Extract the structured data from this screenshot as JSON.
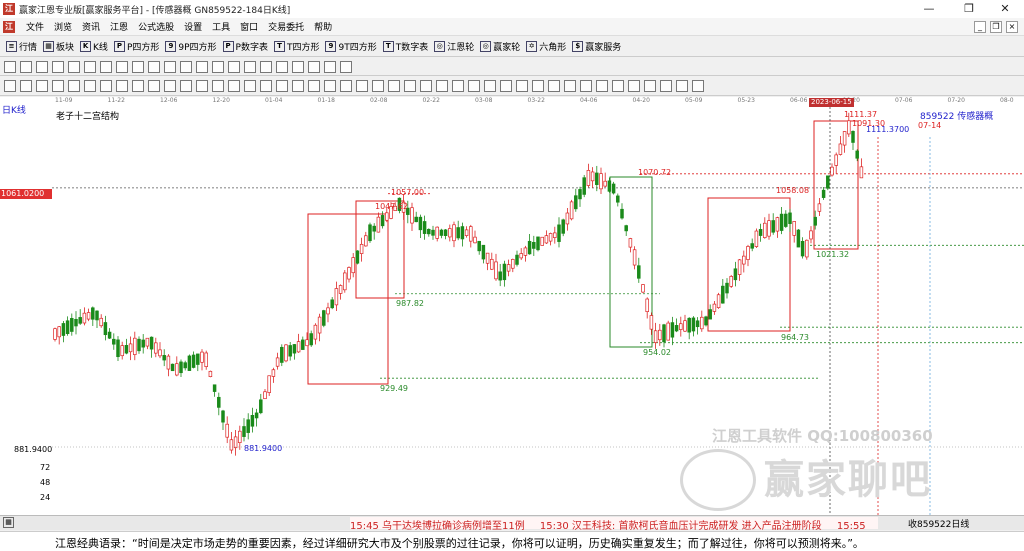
{
  "window": {
    "title": "赢家江恩专业版[赢家服务平台] - [传感器概  GN859522-184日K线]",
    "app_icon": "江"
  },
  "menu": [
    "文件",
    "浏览",
    "资讯",
    "江恩",
    "公式选股",
    "设置",
    "工具",
    "窗口",
    "交易委托",
    "帮助"
  ],
  "toolbar1": [
    {
      "icon": "≡",
      "label": "行情"
    },
    {
      "icon": "▦",
      "label": "板块"
    },
    {
      "icon": "K",
      "label": "K线"
    },
    {
      "icon": "P",
      "label": "P四方形"
    },
    {
      "icon": "9",
      "label": "9P四方形"
    },
    {
      "icon": "P",
      "label": "P数字表"
    },
    {
      "icon": "T",
      "label": "T四方形"
    },
    {
      "icon": "9",
      "label": "9T四方形"
    },
    {
      "icon": "T",
      "label": "T数字表"
    },
    {
      "icon": "◎",
      "label": "江恩轮"
    },
    {
      "icon": "◎",
      "label": "赢家轮"
    },
    {
      "icon": "✡",
      "label": "六角形"
    },
    {
      "icon": "$",
      "label": "赢家服务"
    }
  ],
  "chart": {
    "period_label": "日K线",
    "indicator_label": "老子十二宫结构",
    "security_label": "859522 传感器概",
    "current_price_label": "1061.0200",
    "low_axis_label": "881.9400",
    "low_marker_label": "881.9400",
    "high_marker_label": "1111.3700",
    "high_mark_label": "1111.37",
    "date_highlight": "2023-06-15",
    "future_date_label": "07-14",
    "date_ticks": [
      "11-09",
      "11-22",
      "12-06",
      "12-20",
      "01-04",
      "01-18",
      "02-08",
      "02-22",
      "03-08",
      "03-22",
      "04-06",
      "04-20",
      "05-09",
      "05-23",
      "06-06",
      "06-20",
      "07-06",
      "07-20",
      "08-0"
    ],
    "volume_ticks": [
      "72",
      "48",
      "24"
    ],
    "level_labels": {
      "red": [
        "1057.00",
        "1047.62",
        "1070.72",
        "1058.08",
        "1111.37",
        "1091.30"
      ],
      "green": [
        "987.82",
        "929.49",
        "954.02",
        "964.73",
        "1021.32"
      ]
    }
  },
  "chart_data": {
    "type": "candlestick",
    "title": "",
    "security": "859522 传感器概",
    "period": "日K线",
    "annotated_levels": {
      "low": 881.94,
      "high": 1111.37,
      "current": 1061.02,
      "marks": [
        929.49,
        987.82,
        1047.62,
        1057.0,
        954.02,
        1070.72,
        964.73,
        1058.08,
        1021.32,
        1091.3
      ]
    },
    "ylim": [
      24,
      1120
    ]
  },
  "watermark": {
    "line1": "江恩工具软件  QQ:100800360",
    "line2": "赢家聊吧"
  },
  "bottombar": {
    "news": [
      "15:45 乌干达埃博拉确诊病例增至11例",
      "15:30 汉王科技: 首款柯氏音血压计完成研发 进入产品注册阶段",
      "15:55"
    ],
    "status": "收859522日线"
  },
  "quote": "江恩经典语录：“时间是决定市场走势的重要因素，经过详细研究大市及个别股票的过往记录，你将可以证明，历史确实重复发生；而了解过往，你将可以预测将来。”。"
}
